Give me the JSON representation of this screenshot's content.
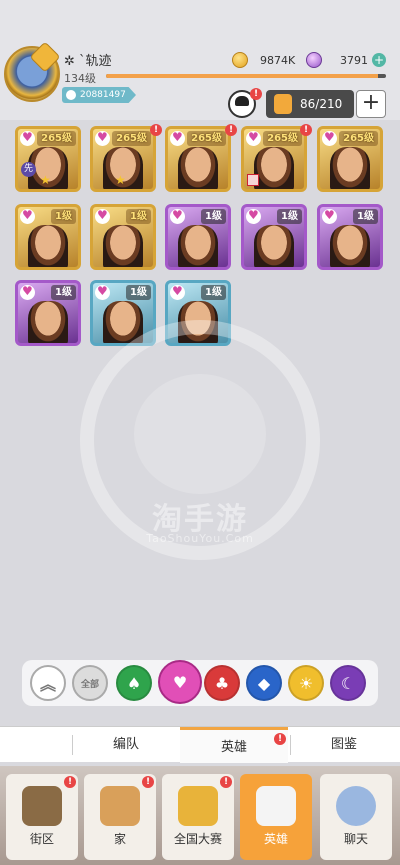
{
  "player": {
    "name": "✲ `轨迹",
    "level": "134级",
    "id": "20881497",
    "exp_percent": 97
  },
  "resources": {
    "coins": "9874K",
    "gems": "3791"
  },
  "hero_count": "86/210",
  "heroes": [
    {
      "level": "265级",
      "frame": "gold",
      "alert": false,
      "tag": "先",
      "star": true
    },
    {
      "level": "265级",
      "frame": "gold",
      "alert": true,
      "star": true
    },
    {
      "level": "265级",
      "frame": "gold",
      "alert": true
    },
    {
      "level": "265级",
      "frame": "gold",
      "alert": true,
      "mark": true
    },
    {
      "level": "265级",
      "frame": "gold",
      "alert": false
    },
    {
      "level": "1级",
      "frame": "gold"
    },
    {
      "level": "1级",
      "frame": "gold"
    },
    {
      "level": "1级",
      "frame": "purple"
    },
    {
      "level": "1级",
      "frame": "purple"
    },
    {
      "level": "1级",
      "frame": "purple"
    },
    {
      "level": "1级",
      "frame": "purple"
    },
    {
      "level": "1级",
      "frame": "blue"
    },
    {
      "level": "1级",
      "frame": "blue"
    }
  ],
  "watermark": {
    "text": "淘手游",
    "sub": "TaoShouYou.Com"
  },
  "filter": {
    "all_label": "全部"
  },
  "subtabs": {
    "formation": "编队",
    "heroes": "英雄",
    "gallery": "图鉴"
  },
  "nav": {
    "street": "街区",
    "home": "家",
    "national": "全国大赛",
    "heroes": "英雄",
    "chat": "聊天"
  }
}
